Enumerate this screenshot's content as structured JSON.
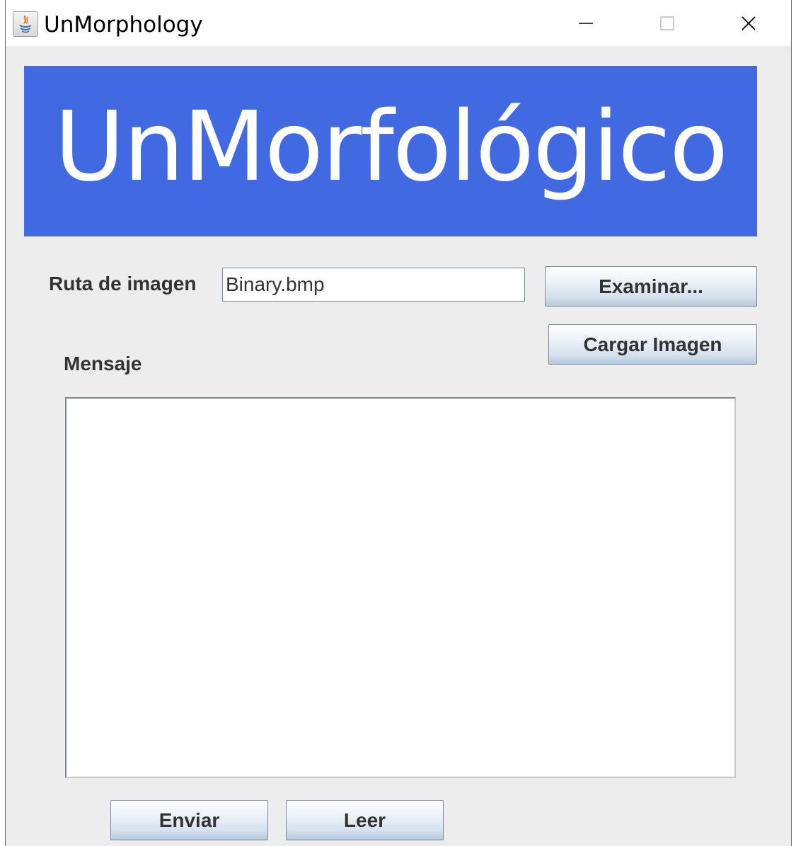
{
  "window": {
    "title": "UnMorphology"
  },
  "banner": {
    "text": "UnMorfológico",
    "background_color": "#4169e1",
    "text_color": "#ffffff"
  },
  "image_path": {
    "label": "Ruta de imagen",
    "value": "Binary.bmp"
  },
  "buttons": {
    "browse": "Examinar...",
    "load_image": "Cargar Imagen",
    "send": "Enviar",
    "read": "Leer"
  },
  "message": {
    "label": "Mensaje",
    "value": ""
  },
  "icons": {
    "app": "java-icon",
    "minimize": "minimize-icon",
    "maximize": "maximize-icon",
    "close": "close-icon"
  }
}
